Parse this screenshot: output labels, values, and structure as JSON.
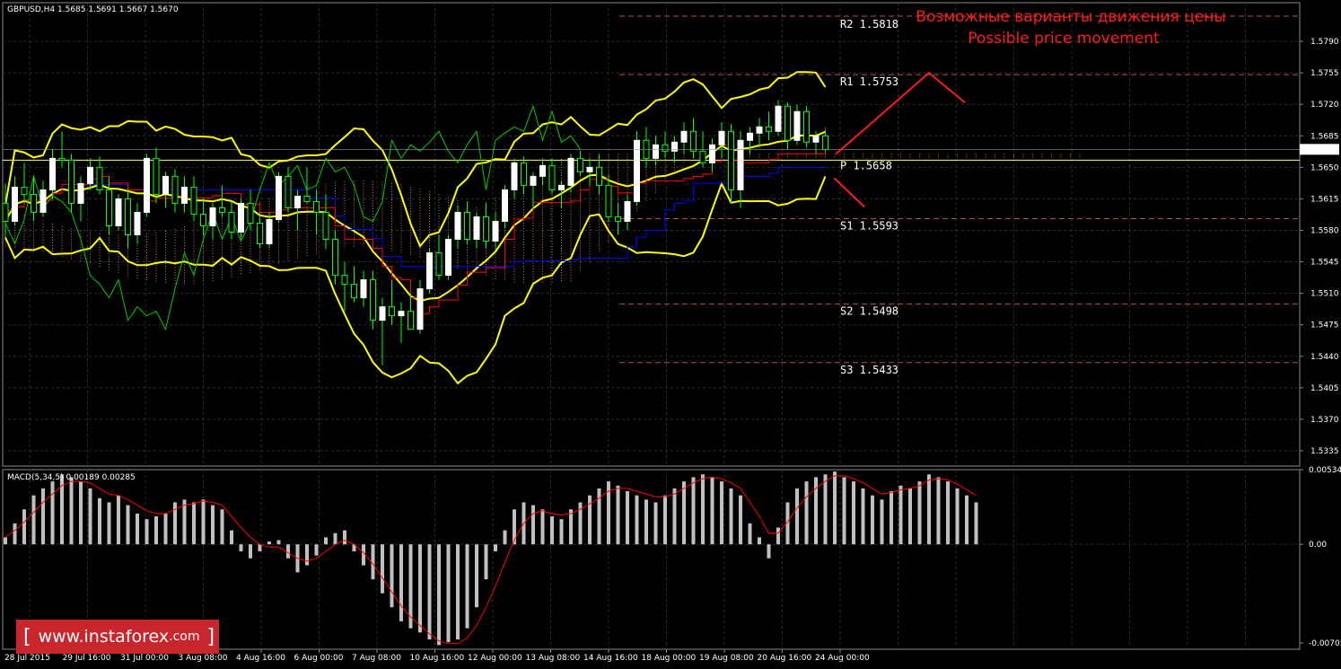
{
  "chart_info": {
    "symbol_header": "GBPUSD,H4  1.5685 1.5691 1.5667 1.5670",
    "macd_header": "MACD(5,34,5) 0.00189 0.00285",
    "current_price_tag": "1.5670"
  },
  "annotation": {
    "ru": "Возможные варианты движения цены",
    "en": "Possible price movement"
  },
  "logo": {
    "left_bracket": "[",
    "text": "www.instaforex",
    "suffix": ".com",
    "right_bracket": "]"
  },
  "colors": {
    "background": "#000000",
    "grid": "#2e2e2e",
    "bull_candle": "#ffffff",
    "bear_candle": "#00ff00",
    "bollinger": "#ffff00",
    "tenkan": "#ff0000",
    "kijun": "#0000ff",
    "chikou": "#00cc00",
    "cloud": "#cc7a5c",
    "level_line": "#b05050",
    "pivot_line": "#ffff66",
    "annotation": "#ff1a1a",
    "macd_hist": "#c0c0c0",
    "macd_signal": "#ff0000"
  },
  "chart_data": [
    {
      "type": "candlestick",
      "title": "GBPUSD,H4",
      "ylim": [
        1.5318,
        1.5833
      ],
      "y_ticks": [
        "1.5790",
        "1.5755",
        "1.5720",
        "1.5685",
        "1.5650",
        "1.5615",
        "1.5580",
        "1.5545",
        "1.5510",
        "1.5475",
        "1.5440",
        "1.5405",
        "1.5370",
        "1.5335"
      ],
      "x_ticks": [
        "28 Jul 2015",
        "29 Jul 16:00",
        "31 Jul 00:00",
        "3 Aug 08:00",
        "4 Aug 16:00",
        "6 Aug 00:00",
        "7 Aug 08:00",
        "10 Aug 16:00",
        "12 Aug 00:00",
        "13 Aug 08:00",
        "14 Aug 16:00",
        "18 Aug 00:00",
        "19 Aug 08:00",
        "20 Aug 16:00",
        "24 Aug 00:00"
      ],
      "series_candles": [
        [
          1.561,
          1.5632,
          1.5572,
          1.559
        ],
        [
          1.559,
          1.564,
          1.5585,
          1.5628
        ],
        [
          1.5628,
          1.5655,
          1.561,
          1.562
        ],
        [
          1.562,
          1.564,
          1.559,
          1.56
        ],
        [
          1.56,
          1.5635,
          1.5595,
          1.5625
        ],
        [
          1.5625,
          1.567,
          1.5615,
          1.566
        ],
        [
          1.566,
          1.569,
          1.565,
          1.5658
        ],
        [
          1.5658,
          1.5665,
          1.56,
          1.561
        ],
        [
          1.561,
          1.564,
          1.559,
          1.5632
        ],
        [
          1.5632,
          1.566,
          1.5625,
          1.565
        ],
        [
          1.565,
          1.5662,
          1.562,
          1.5625
        ],
        [
          1.5625,
          1.564,
          1.5575,
          1.5585
        ],
        [
          1.5585,
          1.562,
          1.558,
          1.5615
        ],
        [
          1.5615,
          1.5625,
          1.556,
          1.5575
        ],
        [
          1.5575,
          1.561,
          1.5565,
          1.56
        ],
        [
          1.56,
          1.5665,
          1.5595,
          1.566
        ],
        [
          1.566,
          1.5672,
          1.561,
          1.562
        ],
        [
          1.562,
          1.5645,
          1.5605,
          1.564
        ],
        [
          1.564,
          1.5648,
          1.56,
          1.561
        ],
        [
          1.561,
          1.564,
          1.56,
          1.5628
        ],
        [
          1.5628,
          1.564,
          1.559,
          1.5598
        ],
        [
          1.5598,
          1.5615,
          1.5575,
          1.5585
        ],
        [
          1.5585,
          1.561,
          1.557,
          1.5605
        ],
        [
          1.5605,
          1.563,
          1.5595,
          1.56
        ],
        [
          1.56,
          1.5612,
          1.557,
          1.5578
        ],
        [
          1.5578,
          1.5615,
          1.5572,
          1.561
        ],
        [
          1.561,
          1.5625,
          1.558,
          1.5588
        ],
        [
          1.5588,
          1.56,
          1.556,
          1.5565
        ],
        [
          1.5565,
          1.56,
          1.556,
          1.5592
        ],
        [
          1.5592,
          1.5645,
          1.5588,
          1.564
        ],
        [
          1.564,
          1.565,
          1.56,
          1.5605
        ],
        [
          1.5605,
          1.5625,
          1.558,
          1.5618
        ],
        [
          1.5618,
          1.565,
          1.561,
          1.5612
        ],
        [
          1.5612,
          1.5625,
          1.5575,
          1.56
        ],
        [
          1.56,
          1.562,
          1.556,
          1.557
        ],
        [
          1.557,
          1.558,
          1.552,
          1.553
        ],
        [
          1.553,
          1.5545,
          1.549,
          1.552
        ],
        [
          1.552,
          1.554,
          1.55,
          1.5505
        ],
        [
          1.5505,
          1.5535,
          1.5495,
          1.5525
        ],
        [
          1.5525,
          1.5535,
          1.547,
          1.548
        ],
        [
          1.548,
          1.5505,
          1.543,
          1.5495
        ],
        [
          1.5495,
          1.5525,
          1.5475,
          1.5485
        ],
        [
          1.5485,
          1.55,
          1.5455,
          1.549
        ],
        [
          1.549,
          1.551,
          1.547,
          1.547
        ],
        [
          1.547,
          1.5525,
          1.5465,
          1.5515
        ],
        [
          1.5515,
          1.556,
          1.551,
          1.5555
        ],
        [
          1.5555,
          1.5575,
          1.5525,
          1.553
        ],
        [
          1.553,
          1.5575,
          1.5525,
          1.557
        ],
        [
          1.557,
          1.5608,
          1.556,
          1.56
        ],
        [
          1.56,
          1.5612,
          1.5565,
          1.557
        ],
        [
          1.557,
          1.56,
          1.556,
          1.5595
        ],
        [
          1.5595,
          1.561,
          1.556,
          1.5568
        ],
        [
          1.5568,
          1.56,
          1.556,
          1.559
        ],
        [
          1.559,
          1.563,
          1.5582,
          1.5625
        ],
        [
          1.5625,
          1.566,
          1.5615,
          1.5655
        ],
        [
          1.5655,
          1.5662,
          1.562,
          1.563
        ],
        [
          1.563,
          1.5645,
          1.5605,
          1.564
        ],
        [
          1.564,
          1.566,
          1.563,
          1.5652
        ],
        [
          1.5652,
          1.566,
          1.562,
          1.5625
        ],
        [
          1.5625,
          1.5635,
          1.5605,
          1.563
        ],
        [
          1.563,
          1.5665,
          1.5622,
          1.566
        ],
        [
          1.566,
          1.5668,
          1.564,
          1.5645
        ],
        [
          1.5645,
          1.566,
          1.563,
          1.565
        ],
        [
          1.565,
          1.5665,
          1.562,
          1.563
        ],
        [
          1.563,
          1.5642,
          1.559,
          1.5595
        ],
        [
          1.5595,
          1.561,
          1.5575,
          1.559
        ],
        [
          1.559,
          1.562,
          1.558,
          1.5612
        ],
        [
          1.5612,
          1.569,
          1.5608,
          1.568
        ],
        [
          1.568,
          1.5695,
          1.565,
          1.566
        ],
        [
          1.566,
          1.5685,
          1.5652,
          1.5675
        ],
        [
          1.5675,
          1.569,
          1.566,
          1.5668
        ],
        [
          1.5668,
          1.5685,
          1.5655,
          1.5678
        ],
        [
          1.5678,
          1.57,
          1.5665,
          1.569
        ],
        [
          1.569,
          1.5705,
          1.566,
          1.5668
        ],
        [
          1.5668,
          1.569,
          1.565,
          1.5655
        ],
        [
          1.5655,
          1.5682,
          1.5645,
          1.5675
        ],
        [
          1.5675,
          1.57,
          1.566,
          1.569
        ],
        [
          1.569,
          1.5698,
          1.561,
          1.5625
        ],
        [
          1.5625,
          1.569,
          1.5605,
          1.568
        ],
        [
          1.568,
          1.5695,
          1.5665,
          1.5688
        ],
        [
          1.5688,
          1.5705,
          1.5672,
          1.5695
        ],
        [
          1.5695,
          1.5712,
          1.568,
          1.569
        ],
        [
          1.569,
          1.5725,
          1.5685,
          1.5718
        ],
        [
          1.5718,
          1.5722,
          1.567,
          1.568
        ],
        [
          1.568,
          1.572,
          1.5675,
          1.5712
        ],
        [
          1.5712,
          1.5718,
          1.5672,
          1.5678
        ],
        [
          1.5678,
          1.569,
          1.5665,
          1.5685
        ],
        [
          1.5685,
          1.5691,
          1.5667,
          1.567
        ]
      ],
      "levels": [
        {
          "name": "R2",
          "label": "R2  1.5818",
          "value": 1.5818
        },
        {
          "name": "R1",
          "label": "R1  1.5753",
          "value": 1.5753
        },
        {
          "name": "P",
          "label": "P  1.5658",
          "value": 1.5658
        },
        {
          "name": "S1",
          "label": "S1  1.5593",
          "value": 1.5593
        },
        {
          "name": "S2",
          "label": "S2  1.5498",
          "value": 1.5498
        },
        {
          "name": "S3",
          "label": "S3  1.5433",
          "value": 1.5433
        }
      ],
      "forecast_paths": [
        {
          "name": "up",
          "points": [
            [
              1.5665,
              1.5755
            ],
            [
              1.5755,
              1.5723
            ]
          ]
        },
        {
          "name": "down",
          "points": [
            [
              1.5638,
              1.5605
            ]
          ]
        }
      ]
    },
    {
      "type": "bar",
      "title": "MACD(5,34,5) 0.00189 0.00285",
      "ylim": [
        -0.0075,
        0.00534
      ],
      "y_ticks": [
        "0.00534",
        "0.00",
        "-0.00705"
      ],
      "histogram": [
        0.0005,
        0.0015,
        0.0025,
        0.0035,
        0.004,
        0.0045,
        0.005,
        0.0048,
        0.0045,
        0.004,
        0.0033,
        0.003,
        0.0035,
        0.0028,
        0.0022,
        0.0018,
        0.002,
        0.0022,
        0.003,
        0.0032,
        0.003,
        0.0032,
        0.0028,
        0.0025,
        0.001,
        -0.0005,
        -0.001,
        -0.0005,
        0.0002,
        0.0003,
        -0.001,
        -0.002,
        -0.0015,
        -0.0008,
        0.0005,
        0.0008,
        0.001,
        -0.0005,
        -0.0015,
        -0.0025,
        -0.0035,
        -0.0045,
        -0.0055,
        -0.006,
        -0.0063,
        -0.0068,
        -0.0072,
        -0.007,
        -0.0068,
        -0.006,
        -0.0045,
        -0.0025,
        -0.0005,
        0.001,
        0.0025,
        0.003,
        0.0028,
        0.0025,
        0.002,
        0.0018,
        0.0025,
        0.003,
        0.0035,
        0.004,
        0.0045,
        0.0042,
        0.0038,
        0.0035,
        0.0032,
        0.003,
        0.0035,
        0.004,
        0.0045,
        0.0048,
        0.005,
        0.0048,
        0.0045,
        0.004,
        0.0035,
        0.0015,
        0.0005,
        -0.001,
        0.0012,
        0.003,
        0.004,
        0.0045,
        0.0048,
        0.005,
        0.0052,
        0.0048,
        0.0045,
        0.004,
        0.0035,
        0.0032,
        0.0038,
        0.0042,
        0.004,
        0.0045,
        0.005,
        0.0048,
        0.0045,
        0.004,
        0.0035,
        0.003
      ],
      "signal": [
        0.0005,
        0.001,
        0.0016,
        0.0023,
        0.003,
        0.0036,
        0.0042,
        0.0045,
        0.0045,
        0.0044,
        0.004,
        0.0036,
        0.0035,
        0.0032,
        0.0028,
        0.0024,
        0.0022,
        0.0022,
        0.0025,
        0.0028,
        0.0029,
        0.0031,
        0.003,
        0.0028,
        0.002,
        0.0012,
        0.0005,
        0.0,
        -0.0002,
        -0.0002,
        -0.0006,
        -0.001,
        -0.0012,
        -0.001,
        -0.0005,
        0.0,
        0.0003,
        0.0,
        -0.0006,
        -0.0014,
        -0.0024,
        -0.0034,
        -0.0044,
        -0.0052,
        -0.0058,
        -0.0064,
        -0.0069,
        -0.0071,
        -0.0071,
        -0.0067,
        -0.0058,
        -0.0045,
        -0.003,
        -0.0013,
        0.0003,
        0.0015,
        0.0022,
        0.0024,
        0.0022,
        0.0021,
        0.0022,
        0.0025,
        0.0029,
        0.0033,
        0.0038,
        0.004,
        0.004,
        0.0038,
        0.0036,
        0.0034,
        0.0034,
        0.0036,
        0.004,
        0.0044,
        0.0047,
        0.0048,
        0.0047,
        0.0044,
        0.004,
        0.003,
        0.002,
        0.0008,
        0.0008,
        0.0016,
        0.0026,
        0.0034,
        0.004,
        0.0045,
        0.0049,
        0.0049,
        0.0047,
        0.0044,
        0.004,
        0.0036,
        0.0037,
        0.0039,
        0.004,
        0.0042,
        0.0046,
        0.0047,
        0.0046,
        0.0043,
        0.0039,
        0.0035
      ]
    }
  ]
}
